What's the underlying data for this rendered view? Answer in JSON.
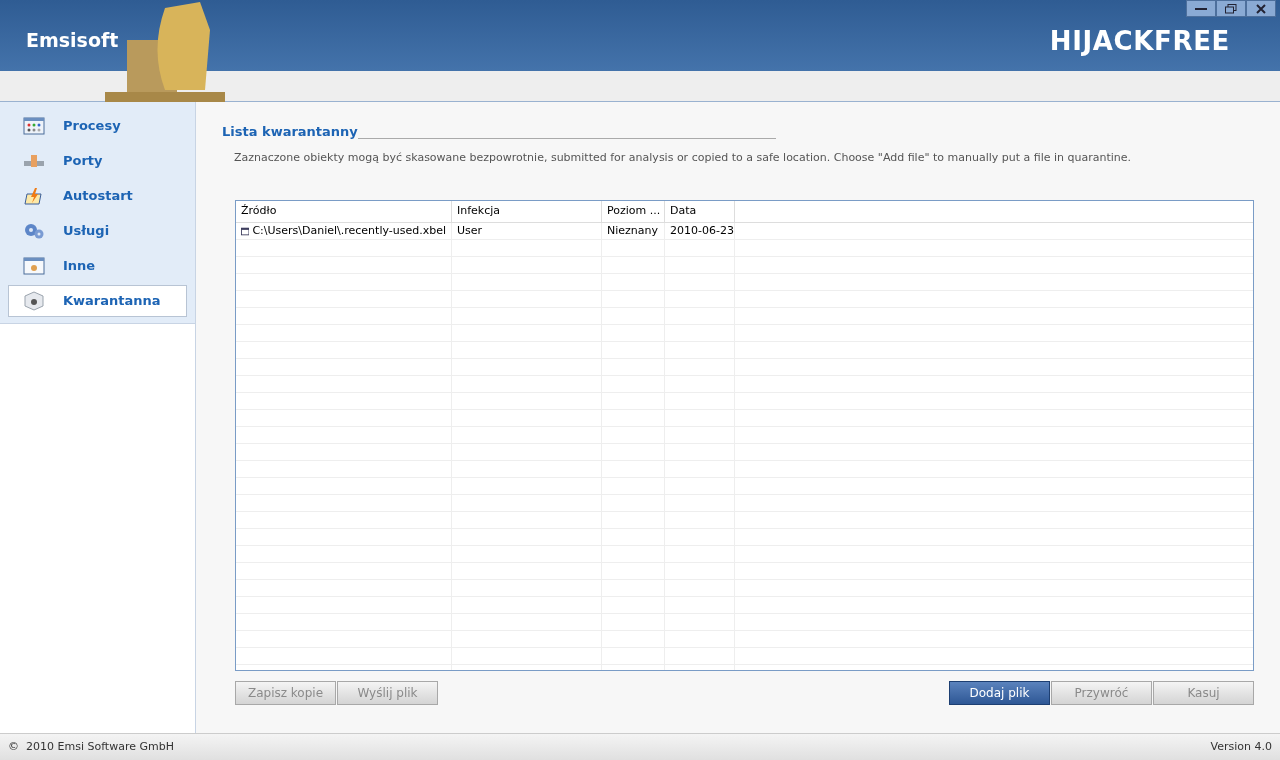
{
  "header": {
    "brand": "Emsisoft",
    "product": "HIJACKFREE"
  },
  "sidebar": {
    "items": [
      {
        "label": "Procesy",
        "selected": false
      },
      {
        "label": "Porty",
        "selected": false
      },
      {
        "label": "Autostart",
        "selected": false
      },
      {
        "label": "Usługi",
        "selected": false
      },
      {
        "label": "Inne",
        "selected": false
      },
      {
        "label": "Kwarantanna",
        "selected": true
      }
    ]
  },
  "content": {
    "title": "Lista kwarantanny",
    "description": "Zaznaczone obiekty mogą być skasowane bezpowrotnie, submitted for analysis or copied to a safe location. Choose \"Add file\" to manually put a file in quarantine.",
    "table": {
      "columns": [
        "Źródło",
        "Infekcja",
        "Poziom ...",
        "Data"
      ],
      "rows": [
        {
          "cells": [
            "C:\\Users\\Daniel\\.recently-used.xbel",
            "User",
            "Nieznany",
            "2010-06-23"
          ],
          "selected": false
        }
      ]
    },
    "left_buttons": [
      {
        "label": "Zapisz kopie",
        "disabled": true
      },
      {
        "label": "Wyślij plik",
        "disabled": true
      }
    ],
    "right_buttons": [
      {
        "label": "Dodaj plik",
        "disabled": false
      },
      {
        "label": "Przywróć",
        "disabled": true
      },
      {
        "label": "Kasuj",
        "disabled": true
      }
    ]
  },
  "status_bar": {
    "copyright": "©  2010 Emsi Software GmbH",
    "version": "Version 4.0"
  }
}
